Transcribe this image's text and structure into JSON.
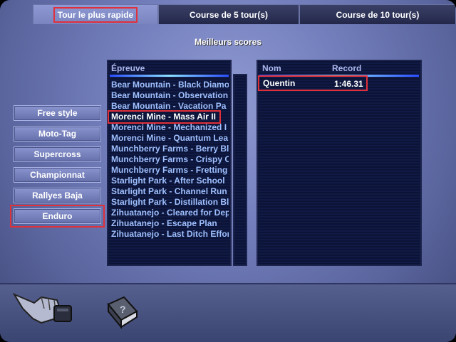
{
  "tabs": [
    {
      "label": "Tour le plus rapide",
      "active": true
    },
    {
      "label": "Course de 5 tour(s)",
      "active": false
    },
    {
      "label": "Course de 10 tour(s)",
      "active": false
    }
  ],
  "section_title": "Meilleurs scores",
  "events": {
    "header": "Épreuve",
    "items": [
      "Bear Mountain - Black Diamo",
      "Bear Mountain - Observation",
      "Bear Mountain - Vacation Pa",
      "Morenci Mine - Mass Air II",
      "Morenci Mine - Mechanized I",
      "Morenci Mine - Quantum Lea",
      "Munchberry Farms - Berry Bl",
      "Munchberry Farms - Crispy C",
      "Munchberry Farms - Fretting",
      "Starlight Park - After School",
      "Starlight Park - Channel Run",
      "Starlight Park - Distillation Bl",
      "Zihuatanejo - Cleared for Dep",
      "Zihuatanejo - Escape Plan",
      "Zihuatanejo - Last Ditch Effor"
    ],
    "selected_index": 3
  },
  "scores": {
    "header_name": "Nom",
    "header_record": "Record",
    "rows": [
      {
        "name": "Quentin",
        "record": "1:46.31"
      }
    ]
  },
  "modes": [
    {
      "label": "Free style",
      "active": false
    },
    {
      "label": "Moto-Tag",
      "active": false
    },
    {
      "label": "Supercross",
      "active": false
    },
    {
      "label": "Championnat",
      "active": false
    },
    {
      "label": "Rallyes Baja",
      "active": false
    },
    {
      "label": "Enduro",
      "active": true
    }
  ],
  "icons": {
    "back": "pointing-hand-icon",
    "help": "help-book-icon"
  },
  "colors": {
    "highlight": "#e0303a",
    "list_text": "#9fc0ff",
    "accent_line": "#8be0ff"
  }
}
